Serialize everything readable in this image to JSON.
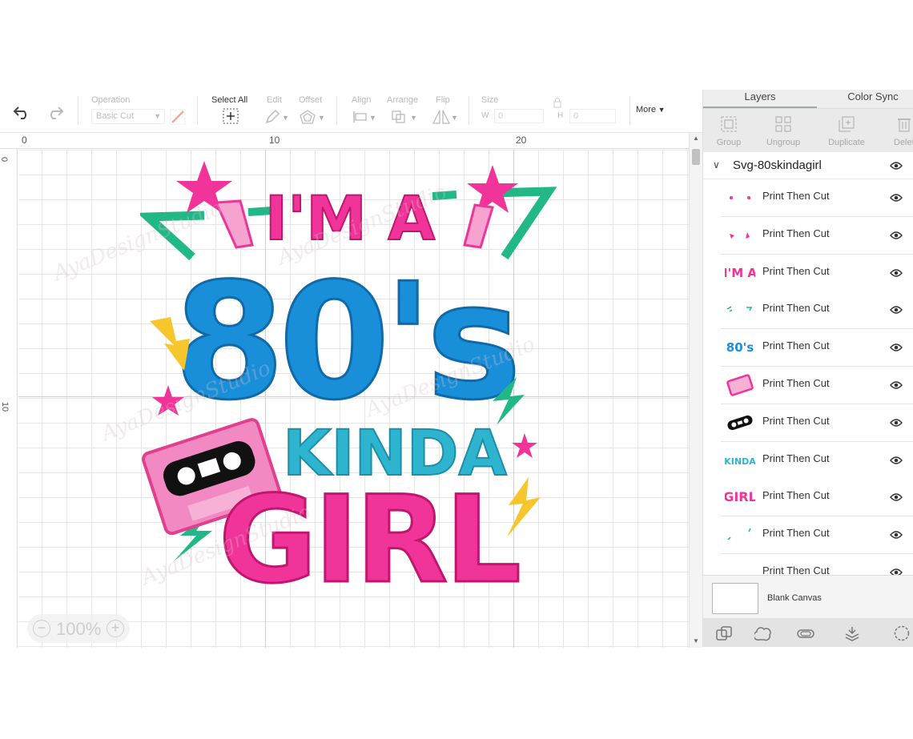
{
  "toolbar": {
    "operation_label": "Operation",
    "operation_value": "Basic Cut",
    "select_all_label": "Select All",
    "edit_label": "Edit",
    "offset_label": "Offset",
    "align_label": "Align",
    "arrange_label": "Arrange",
    "flip_label": "Flip",
    "size_label": "Size",
    "width_label": "W",
    "width_value": "0",
    "height_label": "H",
    "height_value": "0",
    "more_label": "More"
  },
  "ruler": {
    "top_marks": [
      "0",
      "10",
      "20"
    ],
    "left_marks": [
      "0",
      "10"
    ]
  },
  "zoom": {
    "value": "100%"
  },
  "panel": {
    "tabs": [
      {
        "label": "Layers"
      },
      {
        "label": "Color Sync"
      }
    ],
    "actions": [
      {
        "label": "Group"
      },
      {
        "label": "Ungroup"
      },
      {
        "label": "Duplicate"
      },
      {
        "label": "Delete"
      }
    ],
    "group_name": "Svg-80skindagirl",
    "layers": [
      {
        "label": "Print Then Cut",
        "thumb": "dots-icon"
      },
      {
        "label": "Print Then Cut",
        "thumb": "stars-icon"
      },
      {
        "label": "Print Then Cut",
        "thumb": "ima-text-icon",
        "thumb_text": "I'M A"
      },
      {
        "label": "Print Then Cut",
        "thumb": "green-lines-icon"
      },
      {
        "label": "Print Then Cut",
        "thumb": "80s-text-icon",
        "thumb_text": "80's"
      },
      {
        "label": "Print Then Cut",
        "thumb": "pink-cassette-icon"
      },
      {
        "label": "Print Then Cut",
        "thumb": "black-cassette-icon"
      },
      {
        "label": "Print Then Cut",
        "thumb": "kinda-text-icon",
        "thumb_text": "KINDA"
      },
      {
        "label": "Print Then Cut",
        "thumb": "girl-text-icon",
        "thumb_text": "GIRL"
      },
      {
        "label": "Print Then Cut",
        "thumb": "green-bolts-icon"
      },
      {
        "label": "Print Then Cut",
        "thumb": "yellow-bolts-icon"
      }
    ],
    "blank_canvas_label": "Blank Canvas"
  },
  "artwork": {
    "line1": "I'M A",
    "line2": "80's",
    "line3": "KINDA",
    "line4": "GIRL",
    "watermark": "AyaDesignStudio"
  },
  "colors": {
    "pink": "#f0349a",
    "blue": "#1a8fd9",
    "teal": "#2eb4cf",
    "green": "#22b787",
    "yellow": "#f6c62c",
    "black": "#111111"
  }
}
